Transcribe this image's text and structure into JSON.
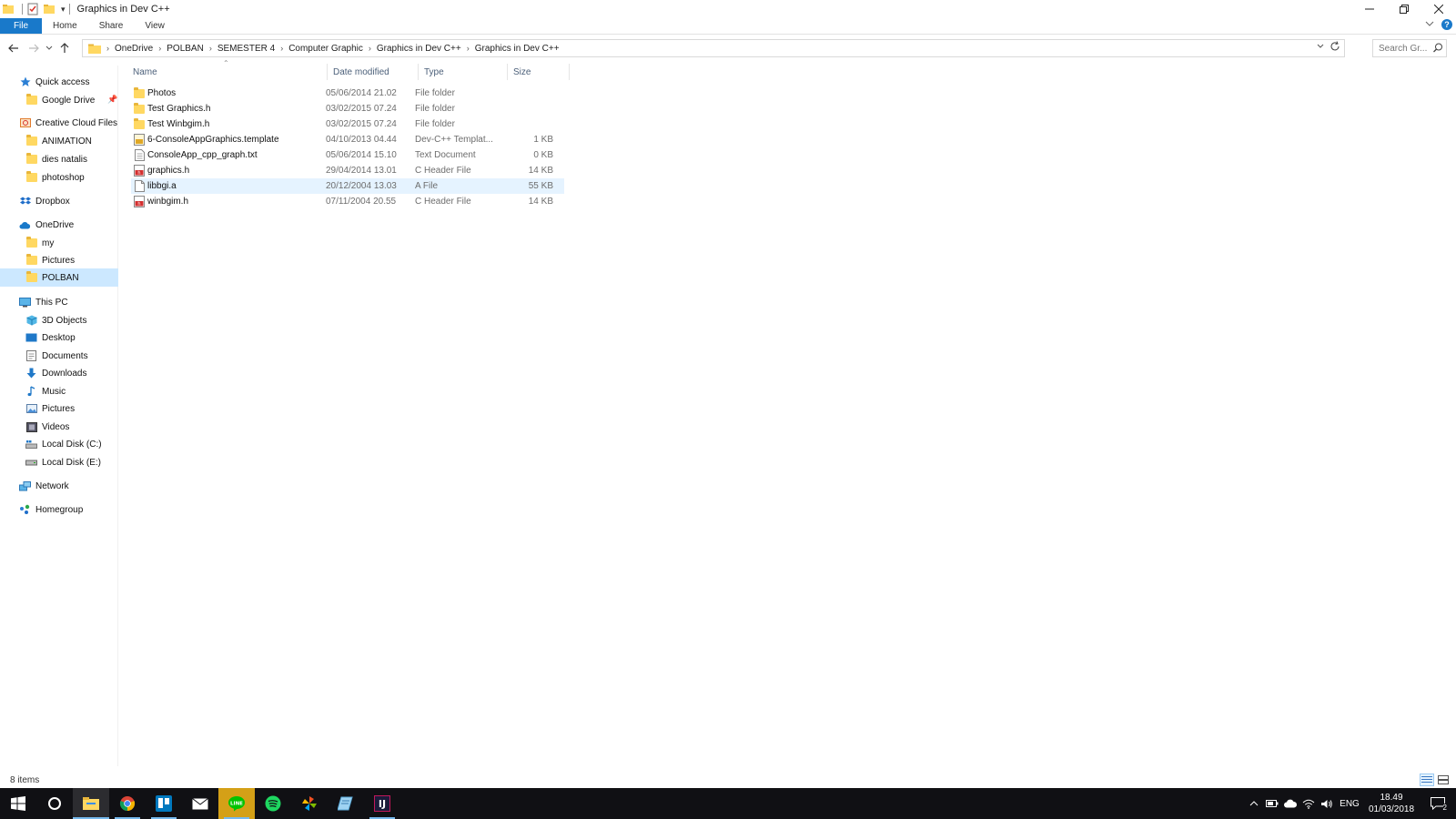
{
  "window": {
    "title": "Graphics in Dev C++",
    "quick_access_dropdown": "▾"
  },
  "ribbon": {
    "tabs": [
      "File",
      "Home",
      "Share",
      "View"
    ],
    "help": "?"
  },
  "address": {
    "crumbs": [
      "OneDrive",
      "POLBAN",
      "SEMESTER 4",
      "Computer Graphic",
      "Graphics in Dev C++",
      "Graphics in Dev C++"
    ],
    "search_placeholder": "Search Gr..."
  },
  "nav": {
    "quick_access": "Quick access",
    "google_drive": "Google Drive",
    "creative_cloud": "Creative Cloud Files",
    "cc_children": [
      "ANIMATION",
      "dies natalis",
      "photoshop"
    ],
    "dropbox": "Dropbox",
    "onedrive": "OneDrive",
    "onedrive_children": [
      "my",
      "Pictures",
      "POLBAN"
    ],
    "this_pc": "This PC",
    "pc_children": [
      "3D Objects",
      "Desktop",
      "Documents",
      "Downloads",
      "Music",
      "Pictures",
      "Videos",
      "Local Disk (C:)",
      "Local Disk (E:)"
    ],
    "network": "Network",
    "homegroup": "Homegroup"
  },
  "columns": {
    "name": "Name",
    "date": "Date modified",
    "type": "Type",
    "size": "Size"
  },
  "files": [
    {
      "name": "Photos",
      "date": "05/06/2014 21.02",
      "type": "File folder",
      "size": "",
      "icon": "folder-icon"
    },
    {
      "name": "Test Graphics.h",
      "date": "03/02/2015 07.24",
      "type": "File folder",
      "size": "",
      "icon": "folder-icon"
    },
    {
      "name": "Test Winbgim.h",
      "date": "03/02/2015 07.24",
      "type": "File folder",
      "size": "",
      "icon": "folder-icon"
    },
    {
      "name": "6-ConsoleAppGraphics.template",
      "date": "04/10/2013 04.44",
      "type": "Dev-C++ Templat...",
      "size": "1 KB",
      "icon": "template-file-icon"
    },
    {
      "name": "ConsoleApp_cpp_graph.txt",
      "date": "05/06/2014 15.10",
      "type": "Text Document",
      "size": "0 KB",
      "icon": "text-file-icon"
    },
    {
      "name": "graphics.h",
      "date": "29/04/2014 13.01",
      "type": "C Header File",
      "size": "14 KB",
      "icon": "header-file-icon"
    },
    {
      "name": "libbgi.a",
      "date": "20/12/2004 13.03",
      "type": "A File",
      "size": "55 KB",
      "icon": "blank-file-icon"
    },
    {
      "name": "winbgim.h",
      "date": "07/11/2004 20.55",
      "type": "C Header File",
      "size": "14 KB",
      "icon": "header-file-icon"
    }
  ],
  "status": {
    "items": "8 items"
  },
  "tray": {
    "lang": "ENG",
    "time": "18.49",
    "date": "01/03/2018",
    "notifications": "2"
  },
  "colors": {
    "accent": "#1979ca",
    "selection": "#cce8ff",
    "hover": "#e5f3ff",
    "folder": "#ffd862",
    "taskbar": "#101014"
  }
}
